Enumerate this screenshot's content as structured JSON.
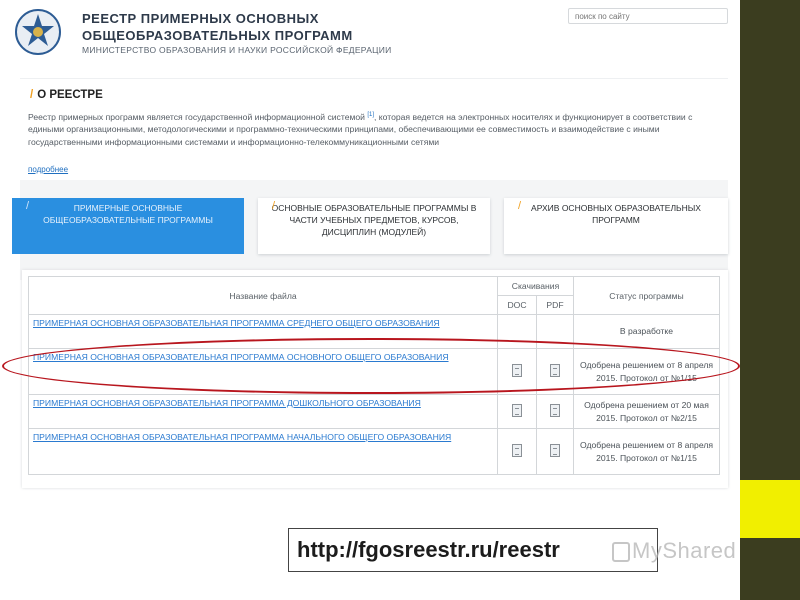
{
  "site": {
    "title_line1": "РЕЕСТР ПРИМЕРНЫХ ОСНОВНЫХ",
    "title_line2": "ОБЩЕОБРАЗОВАТЕЛЬНЫХ ПРОГРАММ",
    "subtitle": "МИНИСТЕРСТВО ОБРАЗОВАНИЯ И НАУКИ РОССИЙСКОЙ ФЕДЕРАЦИИ",
    "search_placeholder": "поиск по сайту"
  },
  "about": {
    "title": "О РЕЕСТРЕ",
    "text_part1": "Реестр примерных программ является государственной информационной системой",
    "footnote": "[1]",
    "text_part2": ", которая ведется на электронных носителях и функционирует в соответствии с едиными организационными, методологическими и программно-техническими принципами, обеспечивающими ее совместимость и взаимодействие с иными государственными информационными системами и информационно-телекоммуникационными сетями",
    "more_link": "подробнее"
  },
  "tabs": [
    {
      "label": "ПРИМЕРНЫЕ ОСНОВНЫЕ ОБЩЕОБРАЗОВАТЕЛЬНЫЕ ПРОГРАММЫ"
    },
    {
      "label": "ОСНОВНЫЕ ОБРАЗОВАТЕЛЬНЫЕ ПРОГРАММЫ В ЧАСТИ УЧЕБНЫХ ПРЕДМЕТОВ, КУРСОВ, ДИСЦИПЛИН (МОДУЛЕЙ)"
    },
    {
      "label": "АРХИВ ОСНОВНЫХ ОБРАЗОВАТЕЛЬНЫХ ПРОГРАММ"
    }
  ],
  "table": {
    "header_name": "Название файла",
    "header_downloads": "Скачивания",
    "header_doc": "DOC",
    "header_pdf": "PDF",
    "header_status": "Статус программы",
    "rows": [
      {
        "name": "ПРИМЕРНАЯ ОСНОВНАЯ ОБРАЗОВАТЕЛЬНАЯ ПРОГРАММА СРЕДНЕГО ОБЩЕГО ОБРАЗОВАНИЯ",
        "status": "В разработке"
      },
      {
        "name": "ПРИМЕРНАЯ ОСНОВНАЯ ОБРАЗОВАТЕЛЬНАЯ ПРОГРАММА ОСНОВНОГО ОБЩЕГО ОБРАЗОВАНИЯ",
        "status": "Одобрена решением от 8 апреля 2015. Протокол от №1/15"
      },
      {
        "name": "ПРИМЕРНАЯ ОСНОВНАЯ ОБРАЗОВАТЕЛЬНАЯ ПРОГРАММА ДОШКОЛЬНОГО ОБРАЗОВАНИЯ",
        "status": "Одобрена решением от 20 мая 2015. Протокол от №2/15"
      },
      {
        "name": "ПРИМЕРНАЯ ОСНОВНАЯ ОБРАЗОВАТЕЛЬНАЯ ПРОГРАММА НАЧАЛЬНОГО ОБЩЕГО ОБРАЗОВАНИЯ",
        "status": "Одобрена решением от 8 апреля 2015. Протокол от №1/15"
      }
    ]
  },
  "url": "http://fgosreestr.ru/reestr",
  "watermark": "MyShared",
  "colors": {
    "accent_blue": "#2a8fe0",
    "accent_orange": "#f0a020",
    "highlight_red": "#b8161e",
    "strip_dark": "#3b3d1f",
    "strip_yellow": "#f1ef00"
  }
}
